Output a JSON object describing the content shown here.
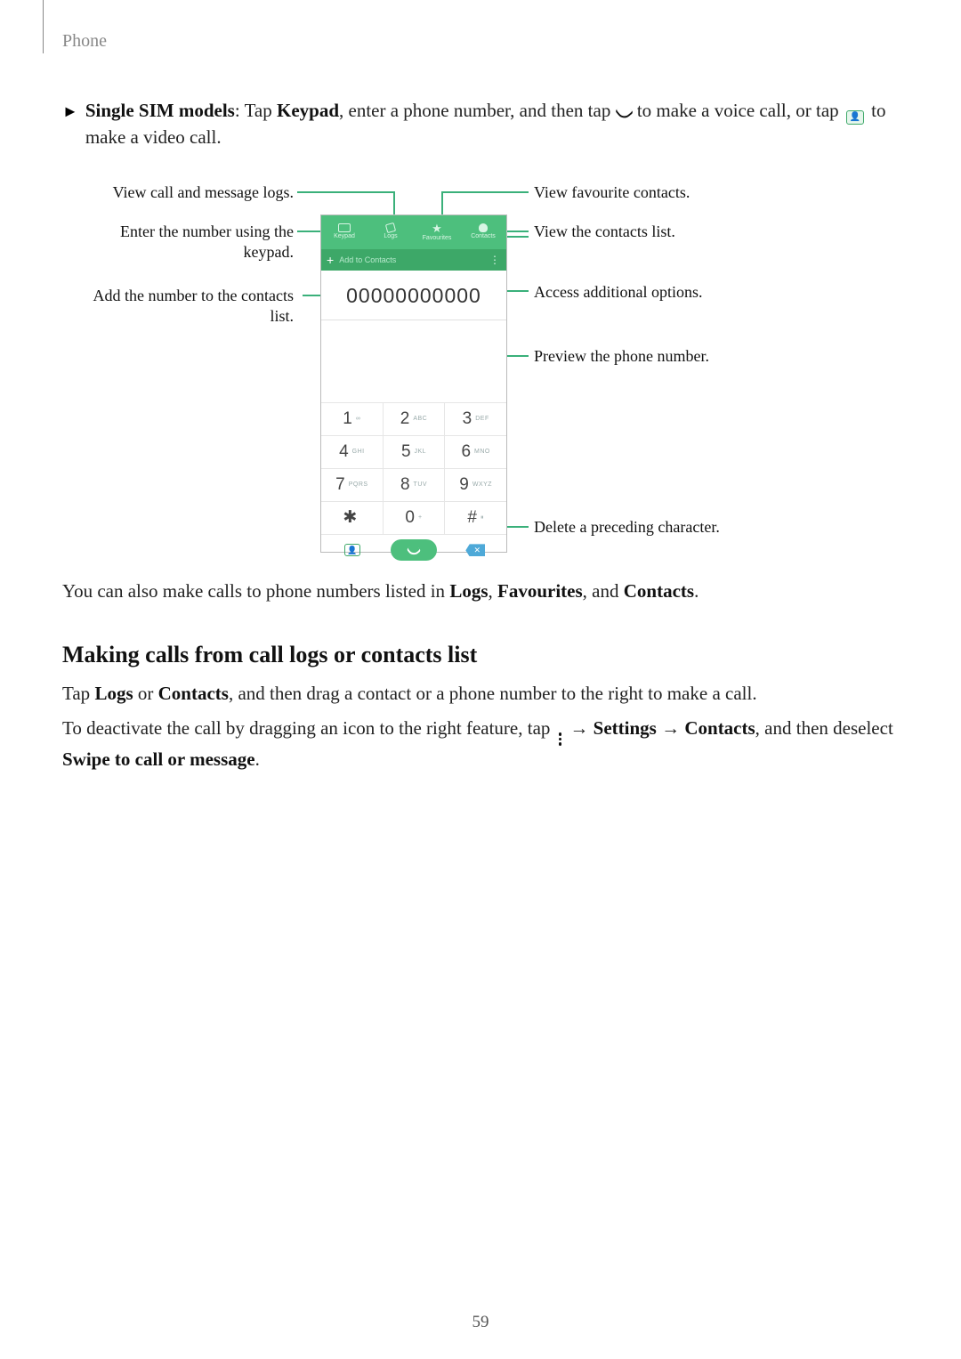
{
  "header": {
    "title": "Phone"
  },
  "intro": {
    "lead_bold": "Single SIM models",
    "tap1": ": Tap ",
    "keypad": "Keypad",
    "middle": ", enter a phone number, and then tap ",
    "after_phone": " to make a voice call, or tap ",
    "after_video": " to make a video call."
  },
  "callouts": {
    "left1": "View call and message logs.",
    "left2a": "Enter the number using the",
    "left2b": "keypad.",
    "left3a": "Add the number to the contacts",
    "left3b": "list.",
    "right1": "View favourite contacts.",
    "right2": "View the contacts list.",
    "right3": "Access additional options.",
    "right4": "Preview the phone number.",
    "right5": "Delete a preceding character."
  },
  "phone": {
    "tabs": {
      "keypad": "Keypad",
      "logs": "Logs",
      "favourites": "Favourites",
      "contacts": "Contacts"
    },
    "addbar": {
      "label": "Add to Contacts"
    },
    "number": "00000000000",
    "keys": {
      "r1": [
        {
          "n": "1",
          "s": "∞"
        },
        {
          "n": "2",
          "s": "ABC"
        },
        {
          "n": "3",
          "s": "DEF"
        }
      ],
      "r2": [
        {
          "n": "4",
          "s": "GHI"
        },
        {
          "n": "5",
          "s": "JKL"
        },
        {
          "n": "6",
          "s": "MNO"
        }
      ],
      "r3": [
        {
          "n": "7",
          "s": "PQRS"
        },
        {
          "n": "8",
          "s": "TUV"
        },
        {
          "n": "9",
          "s": "WXYZ"
        }
      ],
      "r4": [
        {
          "n": "✱",
          "s": " "
        },
        {
          "n": "0",
          "s": "+"
        },
        {
          "n": "#",
          "s": "⏸"
        }
      ]
    }
  },
  "after_diagram": {
    "pre": "You can also make calls to phone numbers listed in ",
    "logs": "Logs",
    "sep1": ", ",
    "fav": "Favourites",
    "sep2": ", and ",
    "contacts": "Contacts",
    "end": "."
  },
  "section2": {
    "heading": "Making calls from call logs or contacts list",
    "p1_pre": "Tap ",
    "p1_logs": "Logs",
    "p1_or": " or ",
    "p1_contacts": "Contacts",
    "p1_rest": ", and then drag a contact or a phone number to the right to make a call.",
    "p2_pre": "To deactivate the call by dragging an icon to the right feature, tap ",
    "p2_arrow1": " → ",
    "p2_settings": "Settings",
    "p2_arrow2": " → ",
    "p2_contacts": "Contacts",
    "p2_mid": ", and then deselect ",
    "p2_swipe": "Swipe to call or message",
    "p2_end": "."
  },
  "page": {
    "number": "59"
  }
}
